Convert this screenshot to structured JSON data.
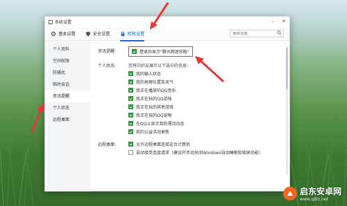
{
  "window": {
    "title": "系统设置"
  },
  "tabs": [
    {
      "label": "基本设置",
      "icon": "gear-icon"
    },
    {
      "label": "安全设置",
      "icon": "shield-icon"
    },
    {
      "label": "权限设置",
      "icon": "lock-icon",
      "active": true
    }
  ],
  "search": {
    "placeholder": "搜索设置"
  },
  "sidebar": {
    "items": [
      {
        "label": "个人资料"
      },
      {
        "label": "空间权限"
      },
      {
        "label": "防骚扰"
      },
      {
        "label": "临时会话"
      },
      {
        "label": "资讯提醒",
        "active": true
      },
      {
        "label": "个人状态"
      },
      {
        "label": "远程桌面"
      }
    ]
  },
  "news": {
    "label": "资讯提醒:",
    "option": "登录后显示\"腾讯网迷你版\"",
    "checked": true
  },
  "status": {
    "label": "个人状态:",
    "hint": "您将向好友展示以下选中的信息:",
    "options": [
      {
        "text": "我的输入状态",
        "checked": true
      },
      {
        "text": "我的地理位置及天气",
        "checked": true
      },
      {
        "text": "我正在播放的QQ音乐",
        "checked": true
      },
      {
        "text": "我正在玩的QQ游戏",
        "checked": true
      },
      {
        "text": "我正在玩的其他游戏",
        "checked": true
      },
      {
        "text": "我正在玩的QQ宠物",
        "checked": true
      },
      {
        "text": "在QQ上显示我的漂流动态",
        "checked": true
      },
      {
        "text": "我的公益活动更新",
        "checked": true
      }
    ]
  },
  "remote": {
    "label": "远程桌面:",
    "options": [
      {
        "text": "允许远程桌面连接这台计算机",
        "checked": true
      },
      {
        "text": "自动接受连接请求（建议开手动关闭Windows自动睡眠和锁屏功能）",
        "checked": false
      }
    ]
  },
  "watermark": {
    "title": "启东安卓网",
    "url": "www.qdtz.net"
  },
  "colors": {
    "accent": "#1b6ec2",
    "check": "#2ea33a",
    "annotation": "#e53935",
    "brand": "#f26522"
  }
}
